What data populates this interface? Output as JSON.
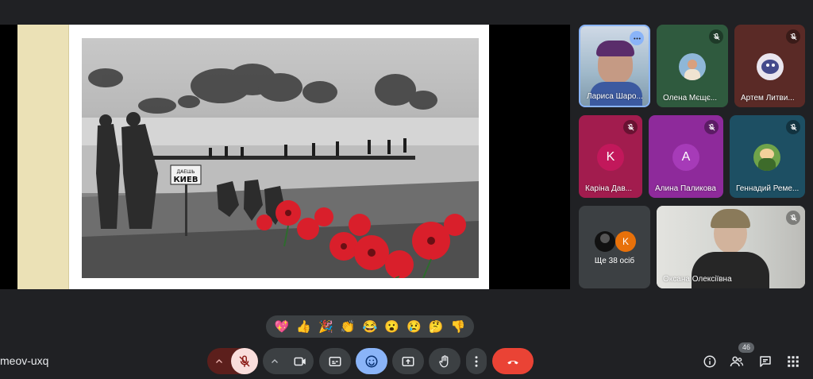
{
  "meeting": {
    "code": "meov-uxq"
  },
  "presentation": {
    "sign_small": "ДАЕШЬ",
    "sign_large": "КИЕВ"
  },
  "participants": [
    {
      "name": "Лариса Шаро...",
      "kind": "video",
      "badge": "more-icon"
    },
    {
      "name": "Олена Мєщє...",
      "kind": "photo",
      "badge": "mic-off-icon"
    },
    {
      "name": "Артем Литви...",
      "kind": "photo",
      "badge": "mic-off-icon"
    },
    {
      "name": "Каріна Дав...",
      "kind": "letter",
      "letter": "K",
      "tile_color": "#a21c4e",
      "avatar_color": "#c2185b",
      "badge": "mic-off-icon"
    },
    {
      "name": "Алина Паликова",
      "kind": "letter",
      "letter": "A",
      "tile_color": "#8e2a9b",
      "avatar_color": "#9c27b0",
      "badge": "mic-off-icon"
    },
    {
      "name": "Геннадий Реме...",
      "kind": "photo",
      "tile_color": "#1d4f63",
      "badge": "mic-off-icon"
    },
    {
      "name": "Ще 38 осіб",
      "kind": "more",
      "letter": "K",
      "avatar_color": "#e8710a"
    },
    {
      "name": "Оксана Олексіївна",
      "kind": "video",
      "badge": "mic-off-icon"
    }
  ],
  "reactions": [
    "💖",
    "👍",
    "🎉",
    "👏",
    "😂",
    "😮",
    "😢",
    "🤔",
    "👎"
  ],
  "controls": {
    "participant_count": "46",
    "colors": {
      "end_call": "#ea4335",
      "mic_off_bg": "#f9dedc",
      "mic_off_chevron_bg": "#5c1f1c",
      "active": "#8ab4f8"
    }
  }
}
